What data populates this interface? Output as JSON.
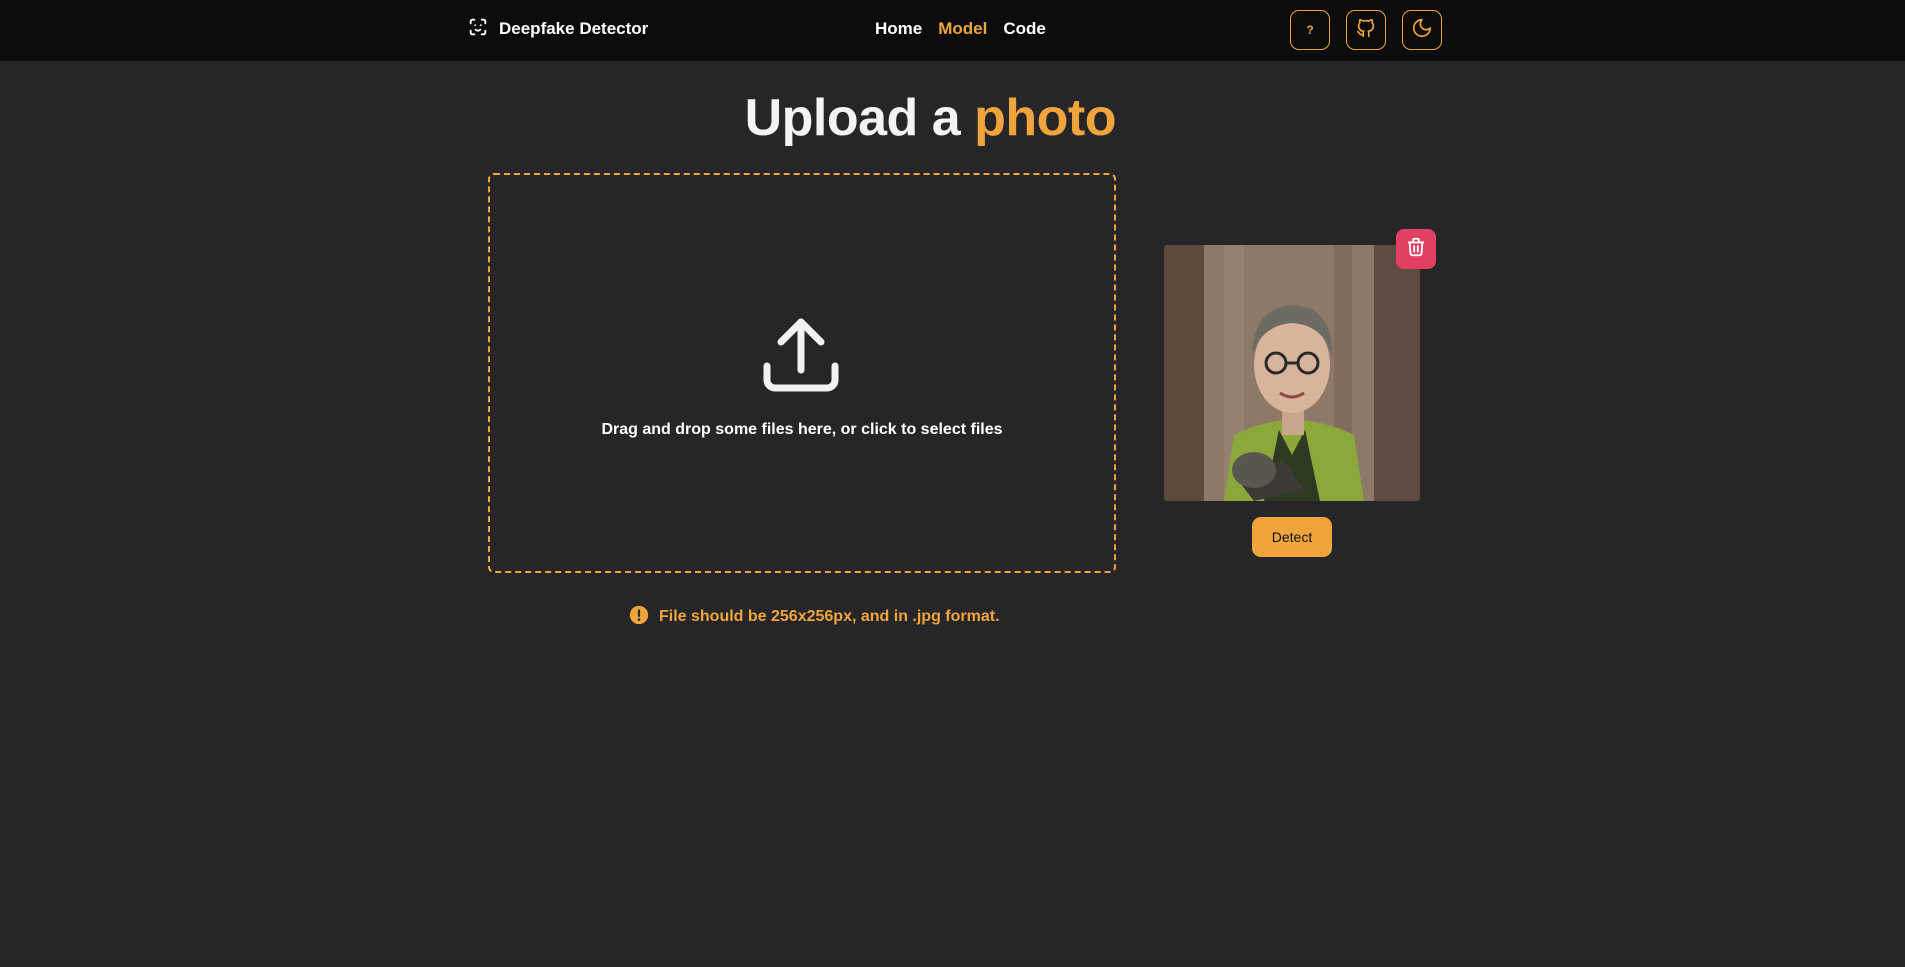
{
  "navbar": {
    "brand_name": "Deepfake Detector",
    "brand_icon": "face-scan-icon",
    "links": [
      {
        "label": "Home",
        "active": false
      },
      {
        "label": "Model",
        "active": true
      },
      {
        "label": "Code",
        "active": false
      }
    ],
    "help_label": "?",
    "github_icon": "github-icon",
    "theme_icon": "moon-icon"
  },
  "page": {
    "title_main": "Upload a",
    "title_accent": "photo"
  },
  "dropzone": {
    "icon": "upload-icon",
    "text": "Drag and drop some files here, or click to select files"
  },
  "preview": {
    "delete_icon": "trash-icon",
    "detect_label": "Detect"
  },
  "notice": {
    "icon": "alert-circle-icon",
    "text": "File should be 256x256px, and in .jpg format."
  },
  "colors": {
    "accent": "#f0a43c",
    "danger": "#e23f63",
    "background": "#262628",
    "navbar": "#0c0c0d"
  }
}
